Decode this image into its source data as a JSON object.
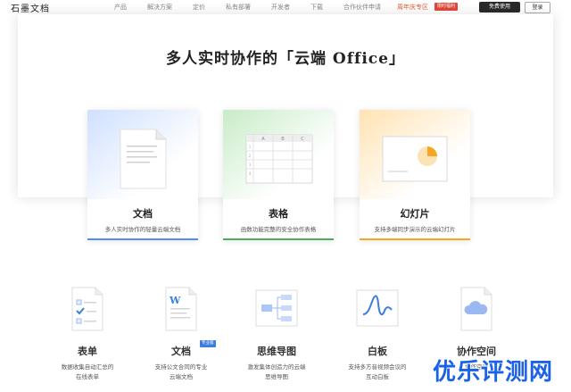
{
  "brand": {
    "logo": "石墨文档"
  },
  "nav": {
    "links": [
      "产品",
      "解决方案",
      "定价",
      "私有部署",
      "开发者",
      "下载",
      "合作伙伴申请"
    ],
    "promo": "周年庆专区",
    "promo_badge": "限时福利",
    "trial_button": "免费使用",
    "login_button": "登录"
  },
  "hero": {
    "title": "多人实时协作的「云端 Office」"
  },
  "cards": [
    {
      "title": "文档",
      "desc": "多人实时协作的轻量云端文档",
      "accent": "#4f8ef7"
    },
    {
      "title": "表格",
      "desc": "函数功能完整的安全协作表格",
      "accent": "#4caf50",
      "cols": [
        "A",
        "B",
        "C"
      ],
      "rows": [
        "1",
        "2",
        "3",
        "4"
      ]
    },
    {
      "title": "幻灯片",
      "desc": "支持多端同步演示的云端幻灯片",
      "accent": "#f5a623"
    }
  ],
  "features": [
    {
      "title": "表单",
      "desc1": "数据收集自动汇总的",
      "desc2": "在线表单"
    },
    {
      "title": "文档",
      "badge": "专业版",
      "desc1": "支持公文合同的专业",
      "desc2": "云端文档"
    },
    {
      "title": "思维导图",
      "desc1": "激发集体创造力的云端",
      "desc2": "思维导图"
    },
    {
      "title": "白板",
      "desc1": "支持多方音视频会议的",
      "desc2": "互动白板"
    },
    {
      "title": "协作空间",
      "desc1": "",
      "desc2": "协作空间"
    }
  ],
  "watermark": "优乐评测网"
}
